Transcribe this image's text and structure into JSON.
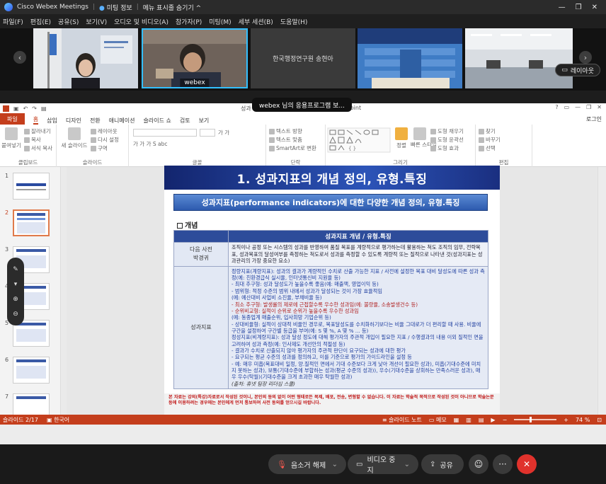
{
  "titlebar": {
    "app": "Cisco Webex Meetings",
    "meeting_info": "미팅 정보",
    "hide_menu": "메뉴 표시줄 숨기기 ^",
    "controls": [
      "—",
      "❐",
      "✕"
    ]
  },
  "menubar": [
    "파일(F)",
    "편집(E)",
    "공유(S)",
    "보기(V)",
    "오디오 및 비디오(A)",
    "참가자(P)",
    "미팅(M)",
    "세부 세션(B)",
    "도움말(H)"
  ],
  "video": {
    "tiles": [
      {
        "name": ""
      },
      {
        "name": "webex"
      },
      {
        "name": "한국행정연구원 송현아"
      },
      {
        "name": ""
      },
      {
        "name": ""
      }
    ],
    "layout_button": "레이아웃"
  },
  "share_banner": "webex 님의 응용프로그램 보...",
  "ppt": {
    "title_left": "성과",
    "title_right": "erPoint",
    "window_controls": [
      "?",
      "▭",
      "—",
      "❐",
      "✕"
    ],
    "tabs": [
      "파일",
      "홈",
      "삽입",
      "디자인",
      "전환",
      "애니메이션",
      "슬라이드 쇼",
      "검토",
      "보기"
    ],
    "login": "로그인",
    "ribbon": {
      "clipboard": {
        "name": "클립보드",
        "paste": "붙여넣기",
        "cut": "잘라내기",
        "copy": "복사",
        "format_copy": "서식 복사"
      },
      "slides": {
        "name": "슬라이드",
        "new_slide": "새 슬라이드",
        "layout": "레이아웃",
        "reset": "다시 설정",
        "section": "구역"
      },
      "font": {
        "name": "글꼴"
      },
      "paragraph": {
        "name": "단락",
        "text_dir": "텍스트 방향",
        "text_align": "텍스트 맞춤",
        "smartart": "SmartArt로 변환"
      },
      "drawing": {
        "name": "그리기",
        "arrange": "정렬",
        "quick_styles": "빠른 스타일",
        "fill": "도형 채우기",
        "outline": "도형 윤곽선",
        "effects": "도형 효과"
      },
      "editing": {
        "name": "편집",
        "find": "찾기",
        "replace": "바꾸기",
        "select": "선택"
      }
    },
    "thumb_numbers": [
      "1",
      "2",
      "3",
      "4",
      "5",
      "6",
      "7"
    ],
    "status": {
      "slide": "슬라이드 2/17",
      "lang": "한국어",
      "notes": "슬라이드 노트",
      "comments": "메모",
      "zoom": "74 %"
    }
  },
  "slide": {
    "title": "1. 성과지표의 개념 정의, 유형.특징",
    "subtitle": "성과지표(performance indicators)에 대한 다양한 개념 정의, 유형.특징",
    "section": "개념",
    "table_header": "성과지표 개념 / 유형.특징",
    "row1_label1": "다음 사전",
    "row1_label2": "박경귀",
    "row1_text": "조직이나 공정 또는 시스템의 성과를 반영하여 품질 목표를 계량적으로 평가하는데 활용하는 척도 조직의 임무, 전략목표, 성과목표의 달성여부를 측정하는 척도로서 성과를 측정할 수 있도록 계량적 또는 질적으로 나타낸 것(성과지표는 성과관리의 가장 중요한 요소)",
    "row2_label": "성과지표",
    "row2_lines": [
      {
        "t": "정량지표(계량지표): 성과의 결과가 계량적인 수치로 산출 가능한 지표 / 사전에 설정한 목표 대비 달성도에 따른 성과 측정(예: 친환경급식 실시율, 인터넷통신비 지원율 등)",
        "c": "l-blue"
      },
      {
        "t": "- 최대 추구형: 성과 달성도가 높을수록 좋음(예: 매출액, 영업이익 등)",
        "c": "l-blue"
      },
      {
        "t": "- 범위형: 적정 수준의 범위 내에서 성과가 달성되는 것이 가장 효율적임",
        "c": "l-blue"
      },
      {
        "t": "          (예: 예산대비 사업비 소진율, 부채비율 등)",
        "c": "l-blue"
      },
      {
        "t": "- 최소 추구형: 발생률의 제로에 근접할수록 우수한 성과임(예: 불량율, 소송발생건수 등)",
        "c": "l-red"
      },
      {
        "t": "- 순위비교형: 실적이 순위로 순위가 높을수록 우수한 성과임",
        "c": "l-red"
      },
      {
        "t": "          (예: 동종업계 매출순위, 입사희망 기업순위 등)",
        "c": "l-blue"
      },
      {
        "t": "- 상대비율형: 실적이 상대적 비율인 경우로, 목표달성도를 수치화하기보다는 비율 그대로가 더 편리할 때 사용. 비율에 구간을 설정하여 구간별 등급을 부여(예: S 몇 %, A 몇 % ... 등)",
        "c": "l-blue"
      },
      {
        "t": "정성지표(비계량지표): 성과 달성 정도에 대해 평가자의 주관적 개입이 필요한 지표 / 수행결과의 내용 이외 질적인 면을 고려하여 성과 측정(예: 인사제도 개선안의 적절성 등)",
        "c": "l-blue"
      },
      {
        "t": "- 결과가 수치로 산출되지 않아 평가자의 주관적 판단이 요구되는 성과에 대한 평가",
        "c": "l-blue"
      },
      {
        "t": "- 요구되는 평균 수준의 성과를 정의하고, 이를 기준으로 평가의 가이드라인을 설정 등",
        "c": "l-blue"
      },
      {
        "t": "- 예: 매우 미흡(목표대비 일정, 양.질적인 면에서 기대 수준보다 크게 낮아 개선이 필요한 성과), 미흡(기대수준에 미치지 못하는 성과), 보통(기대수준에 부합하는 성과(평균 수준의 성과)), 우수(기대수준을 상회하는 만족스러운 성과), 매우 우수(탁월)(기대수준을 크게 초과한 매우 탁월한 성과)",
        "c": "l-blue"
      }
    ],
    "source": "(출처: 휴넷 팀장 리더십 스쿨)",
    "footer": "본 자료는 강의(특강)자료로서 작성된 것이니, 본인의 동의 없이 어떤 형태로든 복제, 배포, 전송, 변형할 수 없습니다. 이 자료는 학술적 목적으로 작성된 것이 아니므로 학술논문 등에 이용하려는 경우에는 본인에게 먼저 통보하여 사전 동의를 얻으시길 바랍니다."
  },
  "controls": {
    "unmute": "음소거 해제",
    "video_stop": "비디오 중지",
    "share": "공유"
  },
  "colors": {
    "ppt_accent": "#c43e1c",
    "slide_title_bg": "#1a3389",
    "end_call": "#e0322c"
  }
}
